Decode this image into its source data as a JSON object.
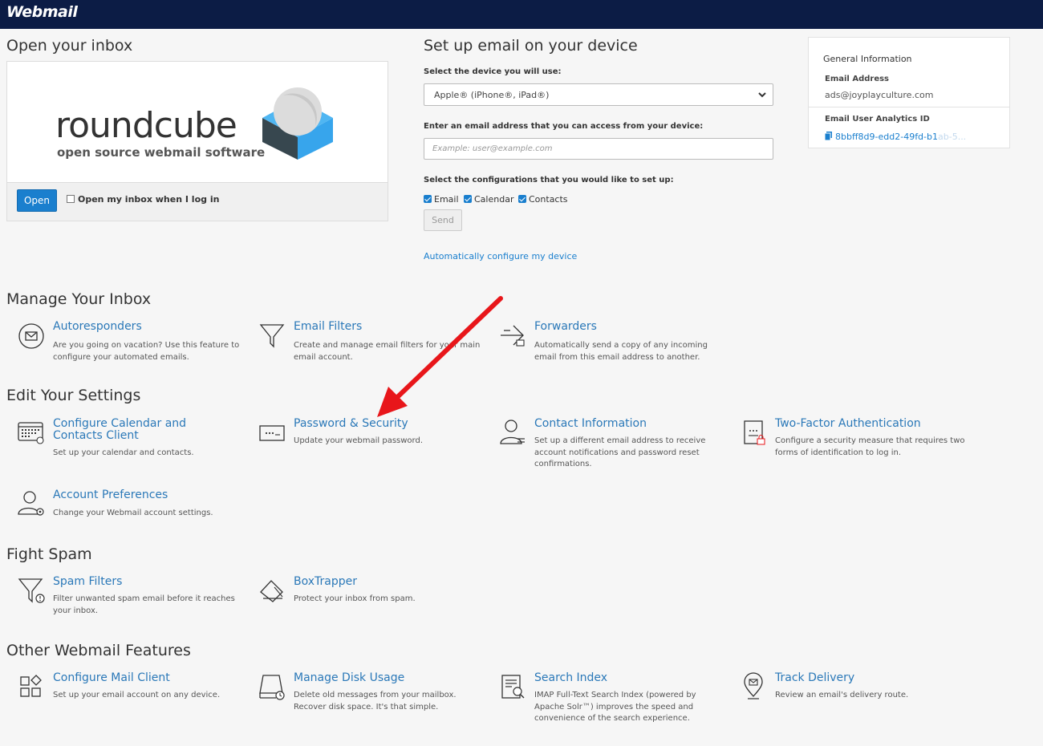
{
  "app": {
    "logo": "Webmail"
  },
  "inbox": {
    "heading": "Open your inbox",
    "logo_word": "roundcube",
    "logo_sub": "open source webmail software",
    "open_label": "Open",
    "auto_open_label": "Open my inbox when I log in"
  },
  "device": {
    "heading": "Set up email on your device",
    "select_label": "Select the device you will use:",
    "select_value": "Apple® (iPhone®, iPad®)",
    "email_label": "Enter an email address that you can access from your device:",
    "email_placeholder": "Example: user@example.com",
    "config_label": "Select the configurations that you would like to set up:",
    "options": [
      "Email",
      "Calendar",
      "Contacts"
    ],
    "send_label": "Send",
    "auto_link": "Automatically configure my device"
  },
  "general": {
    "title": "General Information",
    "email_key": "Email Address",
    "email_value": "ads@joyplayculture.com",
    "analytics_key": "Email User Analytics ID",
    "analytics_value": "8bbff8d9-edd2-49fd-b1",
    "analytics_faded": "ab-5..."
  },
  "sections": {
    "manage": "Manage Your Inbox",
    "settings": "Edit Your Settings",
    "spam": "Fight Spam",
    "other": "Other Webmail Features"
  },
  "features": {
    "autoresponders": {
      "title": "Autoresponders",
      "desc": "Are you going on vacation? Use this feature to configure your automated emails."
    },
    "filters": {
      "title": "Email Filters",
      "desc": "Create and manage email filters for your main email account."
    },
    "forwarders": {
      "title": "Forwarders",
      "desc": "Automatically send a copy of any incoming email from this email address to another."
    },
    "calendar": {
      "title": "Configure Calendar and Contacts Client",
      "desc": "Set up your calendar and contacts."
    },
    "password": {
      "title": "Password & Security",
      "desc": "Update your webmail password."
    },
    "contact": {
      "title": "Contact Information",
      "desc": "Set up a different email address to receive account notifications and password reset confirmations."
    },
    "twofactor": {
      "title": "Two-Factor Authentication",
      "desc": "Configure a security measure that requires two forms of identification to log in."
    },
    "prefs": {
      "title": "Account Preferences",
      "desc": "Change your Webmail account settings."
    },
    "spamfilters": {
      "title": "Spam Filters",
      "desc": "Filter unwanted spam email before it reaches your inbox."
    },
    "boxtrapper": {
      "title": "BoxTrapper",
      "desc": "Protect your inbox from spam."
    },
    "mailclient": {
      "title": "Configure Mail Client",
      "desc": "Set up your email account on any device."
    },
    "disk": {
      "title": "Manage Disk Usage",
      "desc": "Delete old messages from your mailbox. Recover disk space. It's that simple."
    },
    "search": {
      "title": "Search Index",
      "desc": "IMAP Full-Text Search Index (powered by Apache Solr™) improves the speed and convenience of the search experience."
    },
    "track": {
      "title": "Track Delivery",
      "desc": "Review an email's delivery route."
    }
  },
  "colors": {
    "topbar": "#0c1c45",
    "accent": "#1a7fce",
    "link": "#2a78b8",
    "arrow": "#e8161a"
  }
}
